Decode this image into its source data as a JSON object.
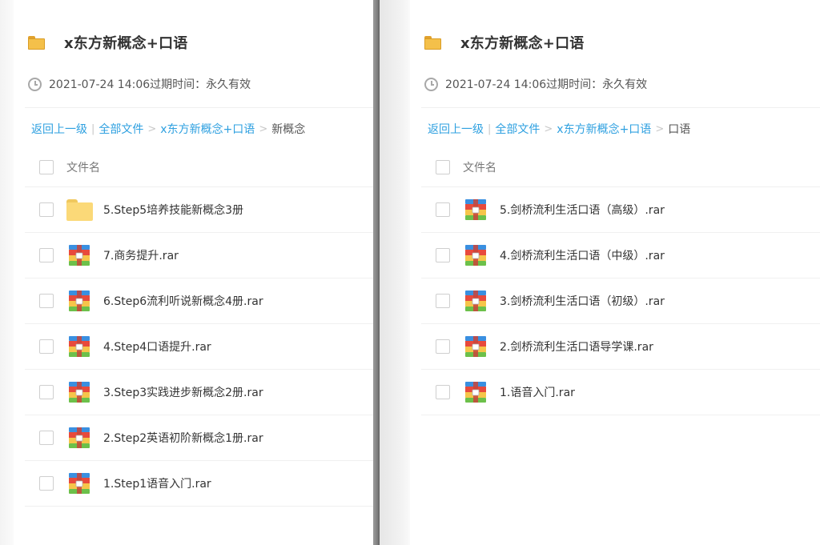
{
  "panels": [
    {
      "header": {
        "title": "x东方新概念+口语",
        "meta": "2021-07-24 14:06过期时间：永久有效"
      },
      "breadcrumb": {
        "back": "返回上一级",
        "all": "全部文件",
        "parent": "x东方新概念+口语",
        "current": "新概念",
        "sep": ">",
        "bar": "|"
      },
      "list": {
        "column_label": "文件名",
        "rows": [
          {
            "name": "5.Step5培养技能新概念3册",
            "icon": "folder-icon"
          },
          {
            "name": "7.商务提升.rar",
            "icon": "rar-archive-icon"
          },
          {
            "name": "6.Step6流利听说新概念4册.rar",
            "icon": "rar-archive-icon"
          },
          {
            "name": "4.Step4口语提升.rar",
            "icon": "rar-archive-icon"
          },
          {
            "name": "3.Step3实践进步新概念2册.rar",
            "icon": "rar-archive-icon"
          },
          {
            "name": "2.Step2英语初阶新概念1册.rar",
            "icon": "rar-archive-icon"
          },
          {
            "name": "1.Step1语音入门.rar",
            "icon": "rar-archive-icon"
          }
        ]
      }
    },
    {
      "header": {
        "title": "x东方新概念+口语",
        "meta": "2021-07-24 14:06过期时间：永久有效"
      },
      "breadcrumb": {
        "back": "返回上一级",
        "all": "全部文件",
        "parent": "x东方新概念+口语",
        "current": "口语",
        "sep": ">",
        "bar": "|"
      },
      "list": {
        "column_label": "文件名",
        "rows": [
          {
            "name": "5.剑桥流利生活口语（高级）.rar",
            "icon": "rar-archive-icon"
          },
          {
            "name": "4.剑桥流利生活口语（中级）.rar",
            "icon": "rar-archive-icon"
          },
          {
            "name": "3.剑桥流利生活口语（初级）.rar",
            "icon": "rar-archive-icon"
          },
          {
            "name": "2.剑桥流利生活口语导学课.rar",
            "icon": "rar-archive-icon"
          },
          {
            "name": "1.语音入门.rar",
            "icon": "rar-archive-icon"
          }
        ]
      }
    }
  ],
  "colors": {
    "link": "#2ea0e0",
    "folder": "#fbd978",
    "rar_blue": "#3a8fe0",
    "rar_red": "#e84a3c",
    "rar_green": "#6cc04a",
    "rar_yellow": "#f6c54a"
  }
}
